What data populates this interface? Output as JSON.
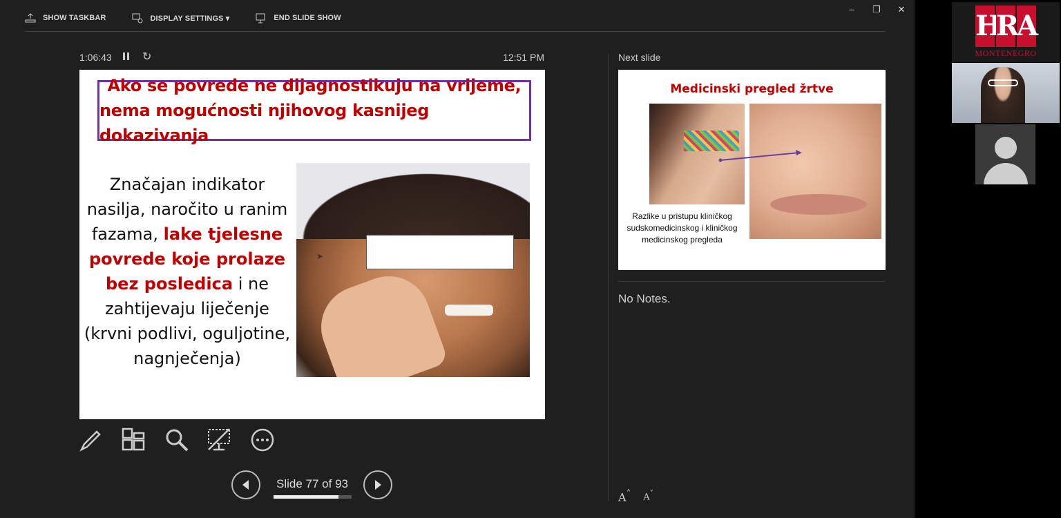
{
  "toolbar": {
    "show_taskbar": "SHOW TASKBAR",
    "display_settings": "DISPLAY SETTINGS ▾",
    "end_slide_show": "END SLIDE SHOW"
  },
  "window_controls": {
    "minimize": "–",
    "restore": "❐",
    "close": "✕"
  },
  "timer": {
    "elapsed": "1:06:43",
    "clock": "12:51 PM"
  },
  "current_slide": {
    "title_line1": "Ako se povrede ne dijagnostikuju na vrijeme,",
    "title_line2": "nema mogućnosti njihovog kasnijeg dokazivanja",
    "body_1": "Značajan indikator nasilja, naročito u ranim fazama, ",
    "body_red": "lake tjelesne povrede koje prolaze bez posledica",
    "body_2": " i ne zahtijevaju liječenje (krvni podlivi, oguljotine, nagnječenja)"
  },
  "navigation": {
    "slide_counter": "Slide 77 of 93",
    "progress": 0.828
  },
  "next_slide": {
    "label": "Next slide",
    "title": "Medicinski pregled žrtve",
    "caption": "Razlike u pristupu kliničkog sudskomedicinskog i kliničkog medicinskog pregleda"
  },
  "notes": {
    "text": "No Notes."
  },
  "font_buttons": {
    "increase": "A",
    "decrease": "A"
  },
  "participants": {
    "logo_letters": [
      "H",
      "R",
      "A"
    ],
    "logo_subtitle": "MONTENEGRO"
  },
  "colors": {
    "title_red": "#c00000",
    "title_border": "#7030a0",
    "logo_red": "#c8102e"
  }
}
